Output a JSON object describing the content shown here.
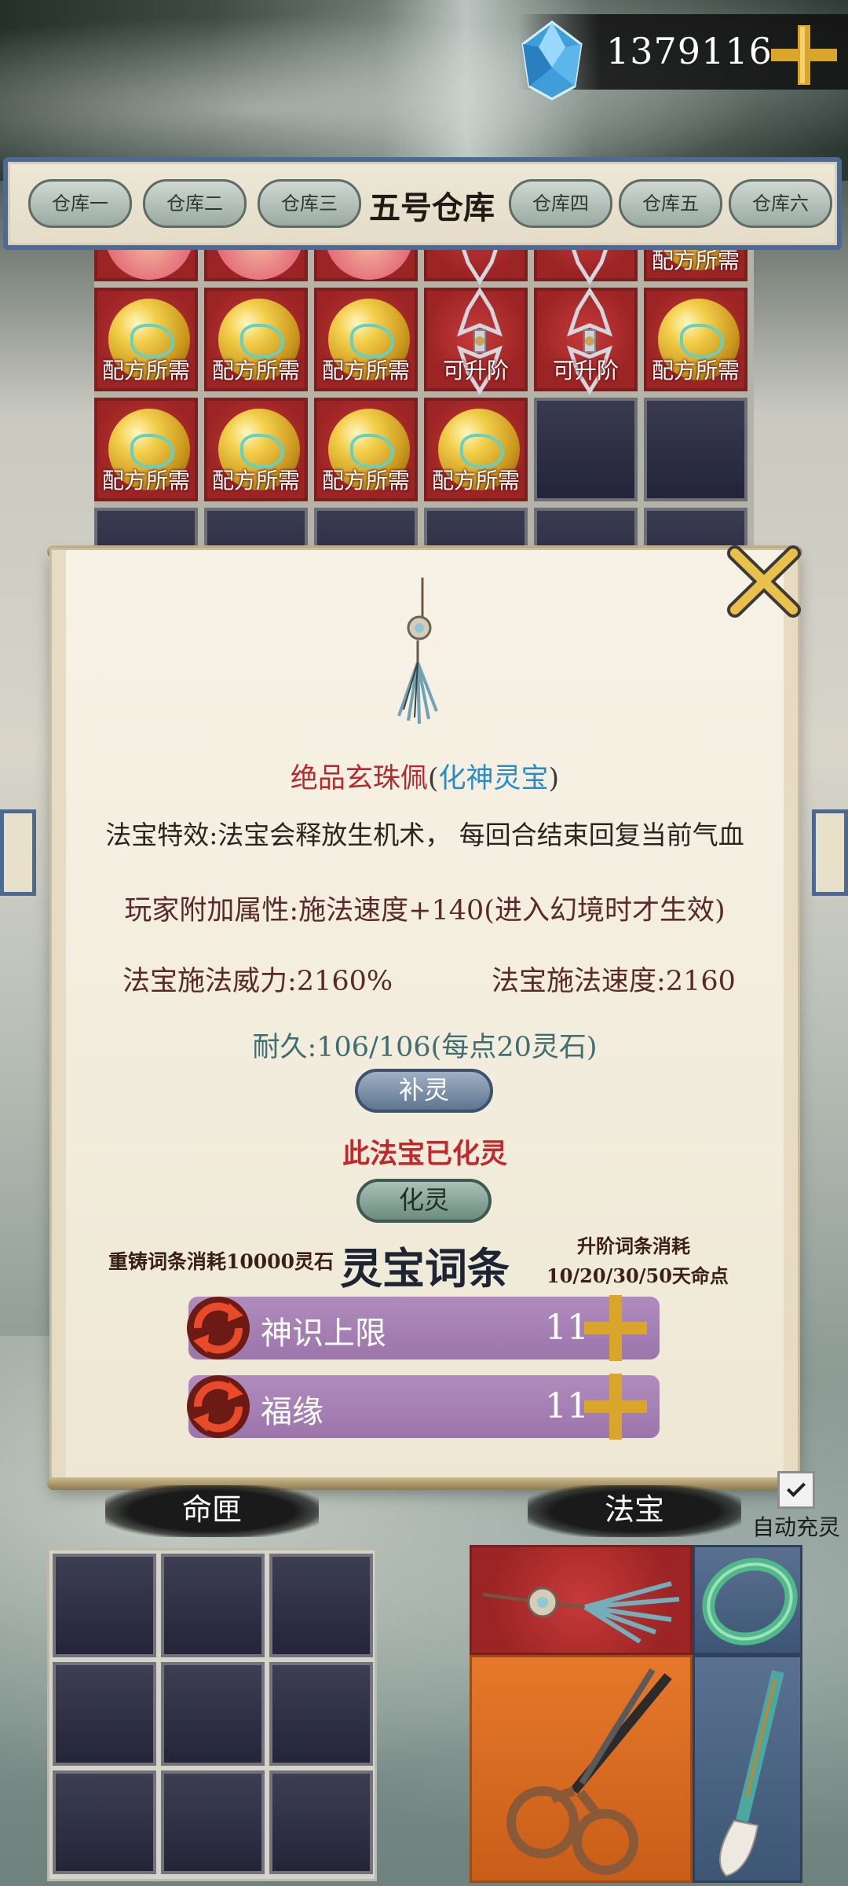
{
  "currency": {
    "amount": "1379116",
    "icon": "blue-crystal-icon",
    "add_icon": "gold-plus-icon"
  },
  "warehouse_tabs": {
    "tabs": [
      "仓库一",
      "仓库二",
      "仓库三",
      "五号仓库",
      "仓库四",
      "仓库五",
      "仓库六"
    ],
    "active_index": 3
  },
  "inventory": {
    "cells": [
      {
        "type": "item-orange",
        "label": ""
      },
      {
        "type": "item-orange",
        "label": ""
      },
      {
        "type": "item-orange",
        "label": ""
      },
      {
        "type": "vajra",
        "label": ""
      },
      {
        "type": "vajra",
        "label": ""
      },
      {
        "type": "orb",
        "label": "配方所需"
      },
      {
        "type": "orb",
        "label": "配方所需"
      },
      {
        "type": "orb",
        "label": "配方所需"
      },
      {
        "type": "orb",
        "label": "配方所需"
      },
      {
        "type": "vajra",
        "label": "可升阶"
      },
      {
        "type": "vajra",
        "label": "可升阶"
      },
      {
        "type": "orb",
        "label": "配方所需"
      },
      {
        "type": "orb",
        "label": "配方所需"
      },
      {
        "type": "orb",
        "label": "配方所需"
      },
      {
        "type": "orb",
        "label": "配方所需"
      },
      {
        "type": "orb",
        "label": "配方所需"
      },
      {
        "type": "empty",
        "label": ""
      },
      {
        "type": "empty",
        "label": ""
      }
    ]
  },
  "detail": {
    "item_name": "绝品玄珠佩",
    "item_type": "化神灵宝",
    "paren_open": "(",
    "paren_close": ")",
    "effect": "法宝特效:法宝会释放生机术，  每回合结束回复当前气血",
    "player_attr": "玩家附加属性:施法速度+140(进入幻境时才生效)",
    "power": "法宝施法威力:2160%",
    "speed": "法宝施法速度:2160",
    "durability": "耐久:106/106(每点20灵石)",
    "refill_button": "补灵",
    "spirit_status": "此法宝已化灵",
    "transform_button": "化灵",
    "recast_cost": "重铸词条消耗10000灵石",
    "affix_title": "灵宝词条",
    "upgrade_cost_line1": "升阶词条消耗",
    "upgrade_cost_line2": "10/20/30/50天命点",
    "affixes": [
      {
        "name": "神识上限",
        "value": "11"
      },
      {
        "name": "福缘",
        "value": "11"
      }
    ],
    "close_icon": "gold-x-close-icon"
  },
  "bottom": {
    "box_header": "命匣",
    "treasure_header": "法宝",
    "auto_charge_label": "自动充灵",
    "auto_charge_checked": true,
    "treasures": [
      "jade-pendant",
      "jade-bracelet",
      "scissors",
      "calligraphy-brush"
    ]
  },
  "colors": {
    "cell_red": "#9c2424",
    "tab_border": "#4e6a92",
    "affix_purple": "#9c76ab",
    "name_red": "#b7282e",
    "type_blue": "#2b8bc4"
  }
}
